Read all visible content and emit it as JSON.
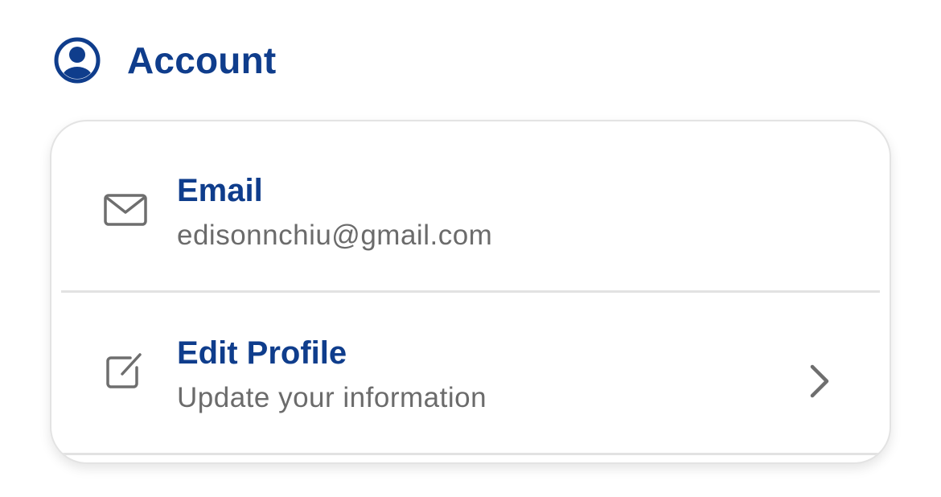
{
  "colors": {
    "accent": "#0f3d8c",
    "subtitle": "#6b6b6b",
    "icon": "#6e6e6e",
    "divider": "#e2e2e2"
  },
  "section": {
    "icon": "user-circle-icon",
    "title": "Account"
  },
  "rows": [
    {
      "icon": "mail-icon",
      "title": "Email",
      "subtitle": "edisonnchiu@gmail.com"
    },
    {
      "icon": "edit-icon",
      "title": "Edit Profile",
      "subtitle": "Update your information",
      "trailing_icon": "chevron-right-icon"
    }
  ]
}
